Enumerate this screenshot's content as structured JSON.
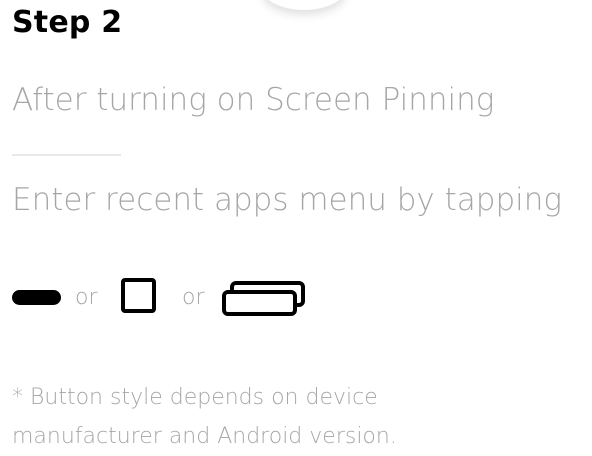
{
  "step": {
    "title": "Step 2",
    "line1": "After turning on Screen Pinning",
    "line2": "Enter recent apps menu by tapping"
  },
  "buttons": {
    "options": [
      {
        "icon": "pill-button-icon"
      },
      {
        "icon": "square-button-icon"
      },
      {
        "icon": "recent-apps-button-icon"
      }
    ],
    "separator": "or"
  },
  "footnote": {
    "line1": "* Button style depends on device",
    "line2": "manufacturer and Android version."
  },
  "colors": {
    "text_primary": "#000000",
    "text_secondary": "#a6a6a6",
    "divider": "#e8e8e8",
    "icon": "#000000"
  }
}
